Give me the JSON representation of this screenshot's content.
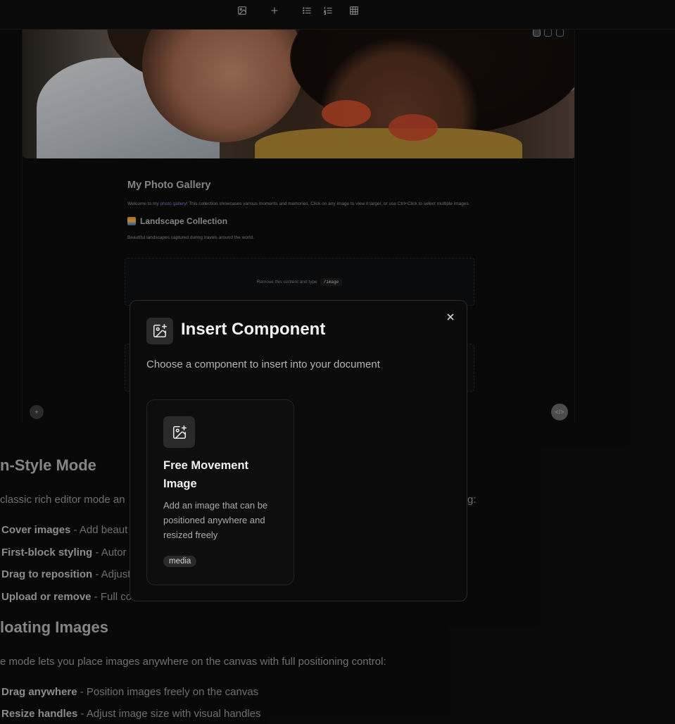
{
  "toolbar": {
    "buttons": [
      "image-icon",
      "plus-icon",
      "bullet-list-icon",
      "numbered-list-icon",
      "table-icon"
    ]
  },
  "document": {
    "title": "My Photo Gallery",
    "intro_before": "Welcome to my ",
    "intro_link": "photo gallery",
    "intro_after": "! This collection showcases various moments and memories. Click on any image to view it larger, or use Ctrl+Click to select multiple images.",
    "landscape_heading": "Landscape Collection",
    "landscape_text": "Beautiful landscapes captured during travels around the world.",
    "placeholder_text": "Remove this content and type",
    "placeholder_code": "/image",
    "add_button": "+",
    "code_button": "</>"
  },
  "background": {
    "section1_heading": "n-Style Mode",
    "section1_intro": "classic rich editor mode an",
    "section1_tail": "g:",
    "items1": [
      {
        "bold": "Cover images",
        "rest": " - Add beaut"
      },
      {
        "bold": "First-block styling",
        "rest": " - Autor"
      },
      {
        "bold": "Drag to reposition",
        "rest": " - Adjust"
      },
      {
        "bold": "Upload or remove",
        "rest": " - Full co"
      }
    ],
    "section2_heading": "loating Images",
    "section2_intro": "e mode lets you place images anywhere on the canvas with full positioning control:",
    "items2": [
      {
        "bold": "Drag anywhere",
        "rest": " - Position images freely on the canvas"
      },
      {
        "bold": "Resize handles",
        "rest": " - Adjust image size with visual handles"
      }
    ]
  },
  "modal": {
    "title": "Insert Component",
    "subtitle": "Choose a component to insert into your document",
    "card": {
      "title": "Free Movement Image",
      "description": "Add an image that can be positioned anywhere and resized freely",
      "tag": "media"
    }
  }
}
